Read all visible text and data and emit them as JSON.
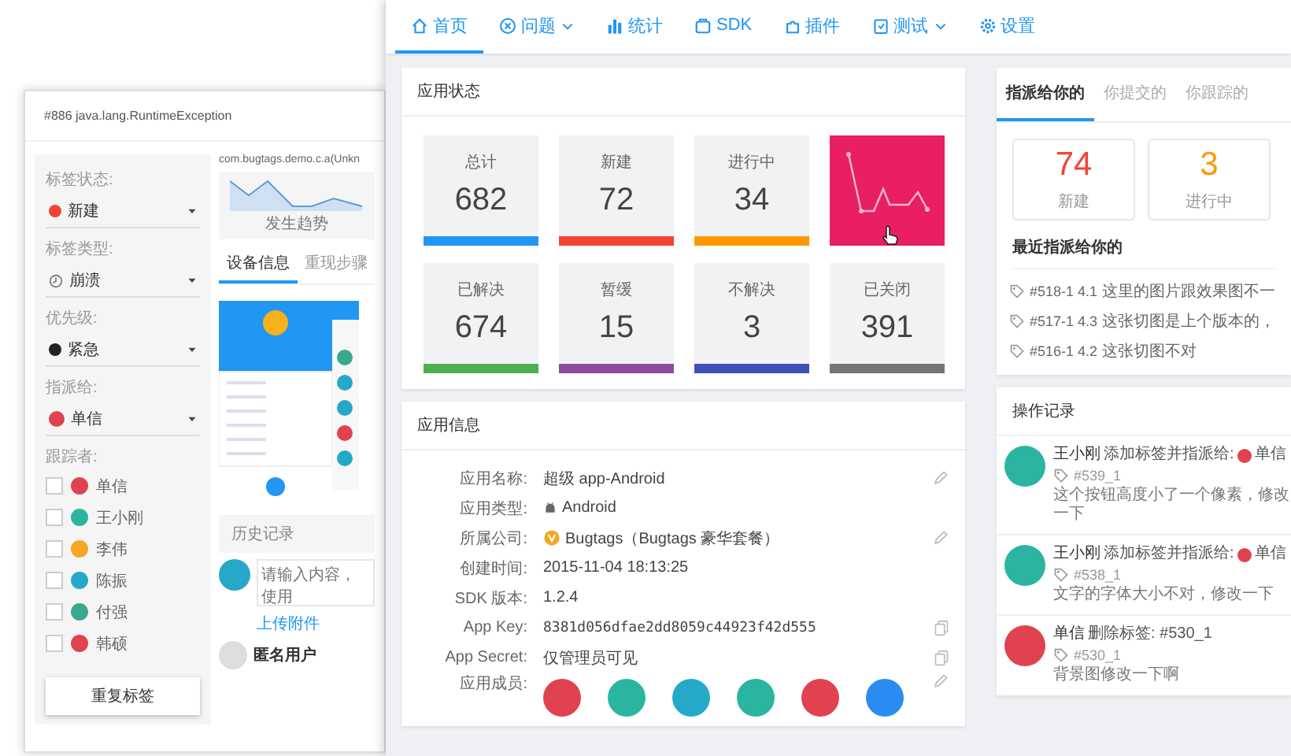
{
  "back_window": {
    "title": "#886 java.lang.RuntimeException",
    "fields": [
      {
        "label": "标签状态:",
        "value": "新建",
        "kind": "dot",
        "color": "#f44336"
      },
      {
        "label": "标签类型:",
        "value": "崩溃",
        "kind": "icon"
      },
      {
        "label": "优先级:",
        "value": "紧急",
        "kind": "dot",
        "color": "#222222"
      },
      {
        "label": "指派给:",
        "value": "单信",
        "kind": "avatar",
        "color": "#e0434f"
      }
    ],
    "followers_label": "跟踪者:",
    "followers": [
      {
        "name": "单信",
        "checked": false,
        "color": "#e0434f"
      },
      {
        "name": "王小刚",
        "checked": false,
        "color": "#2bb5a0"
      },
      {
        "name": "李伟",
        "checked": false,
        "color": "#f5a623"
      },
      {
        "name": "陈振",
        "checked": false,
        "color": "#26a9c8"
      },
      {
        "name": "付强",
        "checked": false,
        "color": "#3aa88f"
      },
      {
        "name": "韩硕",
        "checked": false,
        "color": "#e0434f"
      }
    ],
    "button": "重复标签",
    "source": "com.bugtags.demo.c.a(Unkn",
    "trend_label": "发生趋势",
    "tabs": [
      {
        "label": "设备信息",
        "selected": true
      },
      {
        "label": "重现步骤",
        "selected": false
      }
    ],
    "history_title": "历史记录",
    "comment_placeholder": "请输入内容，使用",
    "upload_link": "上传附件",
    "commenter": "匿名用户"
  },
  "front_window": {
    "nav": [
      {
        "label": "首页",
        "selected": true,
        "dropdown": false
      },
      {
        "label": "问题",
        "selected": false,
        "dropdown": true
      },
      {
        "label": "统计",
        "selected": false,
        "dropdown": false
      },
      {
        "label": "SDK",
        "selected": false,
        "dropdown": false
      },
      {
        "label": "插件",
        "selected": false,
        "dropdown": false
      },
      {
        "label": "测试",
        "selected": false,
        "dropdown": true
      },
      {
        "label": "设置",
        "selected": false,
        "dropdown": false
      }
    ],
    "status_card": {
      "title": "应用状态",
      "tiles": [
        {
          "kind": "count",
          "label": "总计",
          "value": "682",
          "color": "#2196f3"
        },
        {
          "kind": "count",
          "label": "新建",
          "value": "72",
          "color": "#f44336"
        },
        {
          "kind": "count",
          "label": "进行中",
          "value": "34",
          "color": "#ff9800"
        },
        {
          "kind": "sparkline",
          "color": "#e91e63"
        },
        {
          "kind": "count",
          "label": "已解决",
          "value": "674",
          "color": "#4caf50"
        },
        {
          "kind": "count",
          "label": "暂缓",
          "value": "15",
          "color": "#8e4a9e"
        },
        {
          "kind": "count",
          "label": "不解决",
          "value": "3",
          "color": "#3f51b5"
        },
        {
          "kind": "count",
          "label": "已关闭",
          "value": "391",
          "color": "#757575"
        }
      ]
    },
    "info_card": {
      "title": "应用信息",
      "rows": [
        {
          "label": "应用名称:",
          "value": "超级 app-Android",
          "kind": "text",
          "editable": true,
          "copyable": false
        },
        {
          "label": "应用类型:",
          "value": "Android",
          "kind": "android",
          "editable": false,
          "copyable": false
        },
        {
          "label": "所属公司:",
          "value": "Bugtags（Bugtags 豪华套餐）",
          "kind": "company",
          "editable": true,
          "copyable": false
        },
        {
          "label": "创建时间:",
          "value": "2015-11-04 18:13:25",
          "kind": "text",
          "editable": false,
          "copyable": false
        },
        {
          "label": "SDK 版本:",
          "value": "1.2.4",
          "kind": "text",
          "editable": false,
          "copyable": false
        },
        {
          "label": "App Key:",
          "value": "8381d056dfae2dd8059c44923f42d555",
          "kind": "mono",
          "editable": false,
          "copyable": true
        },
        {
          "label": "App Secret:",
          "value": "仅管理员可见",
          "kind": "text",
          "editable": false,
          "copyable": true
        },
        {
          "label": "应用成员:",
          "kind": "members",
          "editable": true,
          "copyable": false,
          "members": [
            {
              "color": "#e0434f"
            },
            {
              "color": "#2bb5a0"
            },
            {
              "color": "#26a9c8"
            },
            {
              "color": "#2bb5a0"
            },
            {
              "color": "#e0434f"
            },
            {
              "color": "#2a8cf0"
            }
          ]
        }
      ]
    },
    "assigned_card": {
      "tabs": [
        {
          "label": "指派给你的",
          "selected": true
        },
        {
          "label": "你提交的",
          "selected": false
        },
        {
          "label": "你跟踪的",
          "selected": false
        }
      ],
      "counts": [
        {
          "value": "74",
          "label": "新建",
          "color": "#f44336"
        },
        {
          "value": "3",
          "label": "进行中",
          "color": "#ff9800"
        }
      ],
      "recent_title": "最近指派给你的",
      "recent": [
        {
          "ref": "#518-1 4.1",
          "text": "这里的图片跟效果图不一"
        },
        {
          "ref": "#517-1 4.3",
          "text": "这张切图是上个版本的，"
        },
        {
          "ref": "#516-1 4.2",
          "text": "这张切图不对"
        }
      ]
    },
    "log_card": {
      "title": "操作记录",
      "entries": [
        {
          "user": "王小刚",
          "action": "添加标签并指派给:",
          "assignee": {
            "name": "单信",
            "color": "#e0434f"
          },
          "tag": "#539_1",
          "note": "这个按钮高度小了一个像素，修改一下",
          "color": "#2bb5a0"
        },
        {
          "user": "王小刚",
          "action": "添加标签并指派给:",
          "assignee": {
            "name": "单信",
            "color": "#e0434f"
          },
          "tag": "#538_1",
          "note": "文字的字体大小不对，修改一下",
          "color": "#2bb5a0"
        },
        {
          "user": "单信",
          "action": "删除标签: #530_1",
          "tag": "#530_1",
          "note": "背景图修改一下啊",
          "color": "#e0434f"
        }
      ]
    }
  }
}
